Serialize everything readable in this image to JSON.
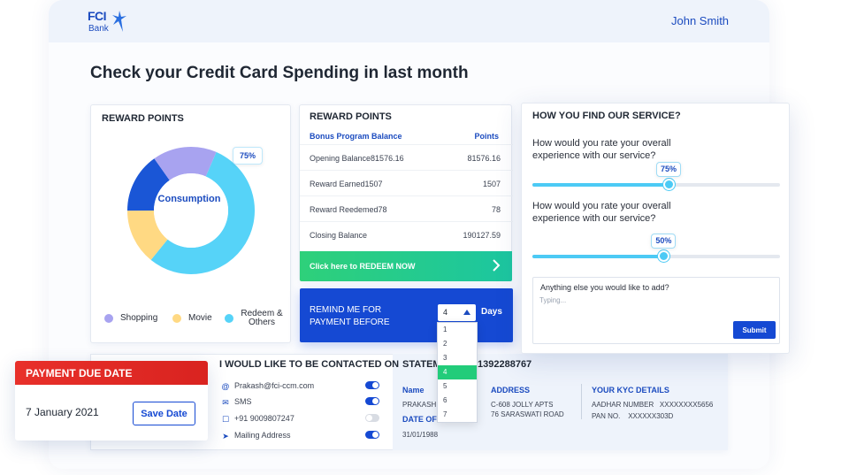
{
  "header": {
    "logo_text": "FCI",
    "logo_subtext": "Bank",
    "user_name": "John Smith"
  },
  "page_title": "Check your Credit Card Spending in last month",
  "donut_card": {
    "title": "REWARD POINTS",
    "center_label": "Consumption",
    "badge": "75%",
    "segments": [
      {
        "name": "Consumption",
        "value": 50,
        "color": "#56d3f8"
      },
      {
        "name": "Movie",
        "value": 13,
        "color": "#ffd983"
      },
      {
        "name": "Shopping-dark",
        "value": 14,
        "color": "#1a56d6"
      },
      {
        "name": "Shopping",
        "value": 15,
        "color": "#a8a3f0"
      }
    ],
    "legend": [
      {
        "label": "Shopping",
        "color": "#a8a3f0"
      },
      {
        "label": "Movie",
        "color": "#ffd983"
      },
      {
        "label": "Redeem & Others",
        "color": "#56d3f8"
      }
    ]
  },
  "reward_card": {
    "title": "REWARD POINTS",
    "col_label": "Bonus Program Balance",
    "col_points": "Points",
    "rows": [
      {
        "label": "Opening Balance81576.16",
        "value": "81576.16"
      },
      {
        "label": "Reward Earned1507",
        "value": "1507"
      },
      {
        "label": "Reward Reedemed78",
        "value": "78"
      },
      {
        "label": "Closing Balance",
        "value": "190127.59"
      }
    ],
    "redeem_label": "Click here to REDEEM NOW"
  },
  "remind": {
    "text": "REMIND ME FOR PAYMENT BEFORE",
    "selected": "4",
    "unit": "Days",
    "options": [
      "1",
      "2",
      "3",
      "4",
      "5",
      "6",
      "7"
    ],
    "selected_index": 3
  },
  "survey": {
    "title": "HOW YOU FIND OUR SERVICE?",
    "questions": [
      {
        "text": "How would you rate your overall experience with our service?",
        "value_label": "75%",
        "value": 0.55
      },
      {
        "text": "How would you rate your overall experience with our service?",
        "value_label": "50%",
        "value": 0.53
      }
    ],
    "comment_label": "Anything else you would like to add?",
    "comment_placeholder": "Typing...",
    "submit_label": "Submit"
  },
  "payment_due": {
    "title": "PAYMENT DUE DATE",
    "date": "7 January 2021",
    "save_label": "Save Date"
  },
  "contact": {
    "title": "I WOULD LIKE TO BE CONTACTED ON",
    "items": [
      {
        "icon": "@",
        "label": "Prakash@fci-ccm.com",
        "on": true
      },
      {
        "icon": "✉",
        "label": "SMS",
        "on": true
      },
      {
        "icon": "☐",
        "label": "+91 9009807247",
        "on": false
      },
      {
        "icon": "➤",
        "label": "Mailing Address",
        "on": true
      }
    ]
  },
  "statement": {
    "title": "STATEM",
    "phone": "1392288767",
    "name_label": "Name",
    "name_value": "PRAKASH",
    "date_label": "DATE OF",
    "date_value": "31/01/1988",
    "address_label": "ADDRESS",
    "address_line1": "C-608 JOLLY APTS",
    "address_line2": "76 SARASWATI ROAD",
    "kyc_label": "YOUR KYC DETAILS",
    "aadhar": "AADHAR NUMBER   XXXXXXXX5656",
    "pan": "PAN NO.    XXXXXX303D"
  }
}
